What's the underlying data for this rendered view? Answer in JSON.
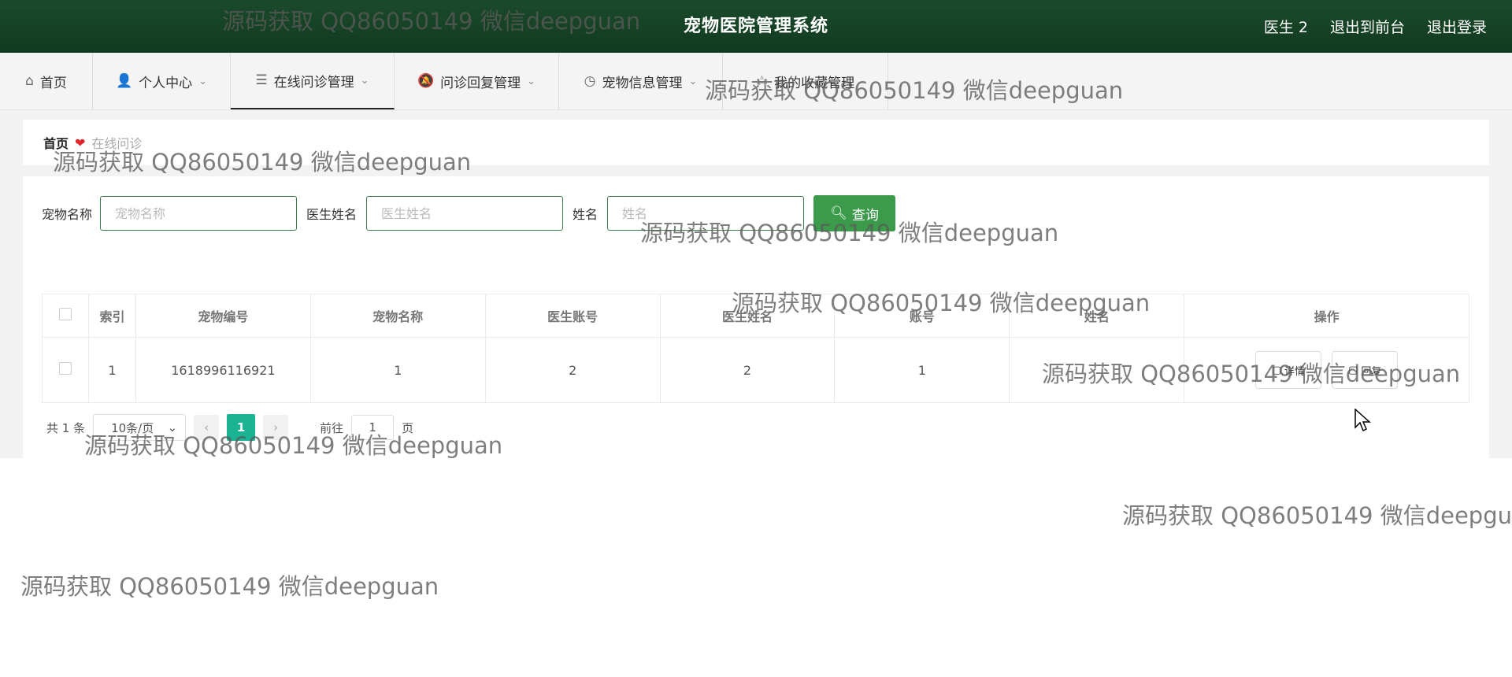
{
  "header": {
    "title": "宠物医院管理系统",
    "user": "医生 2",
    "to_frontend": "退出到前台",
    "logout": "退出登录"
  },
  "nav": {
    "items": [
      {
        "label": "首页",
        "icon": "home-icon"
      },
      {
        "label": "个人中心",
        "icon": "user-icon"
      },
      {
        "label": "在线问诊管理",
        "icon": "list-icon"
      },
      {
        "label": "问诊回复管理",
        "icon": "bell-icon"
      },
      {
        "label": "宠物信息管理",
        "icon": "clock-icon"
      },
      {
        "label": "我的收藏管理",
        "icon": "star-icon"
      }
    ],
    "active_index": 2
  },
  "breadcrumb": {
    "home": "首页",
    "current": "在线问诊"
  },
  "search": {
    "pet_name_label": "宠物名称",
    "pet_name_placeholder": "宠物名称",
    "doctor_name_label": "医生姓名",
    "doctor_name_placeholder": "医生姓名",
    "name_label": "姓名",
    "name_placeholder": "姓名",
    "query_button": "查询"
  },
  "table": {
    "columns": [
      "索引",
      "宠物编号",
      "宠物名称",
      "医生账号",
      "医生姓名",
      "账号",
      "姓名",
      "操作"
    ],
    "rows": [
      {
        "index": "1",
        "pet_no": "1618996116921",
        "pet_name": "1",
        "doctor_account": "2",
        "doctor_name": "2",
        "account": "1",
        "name": ""
      }
    ],
    "actions": {
      "detail": "详情",
      "reply": "回复"
    }
  },
  "pagination": {
    "total": "共 1 条",
    "page_size": "10条/页",
    "current_page": "1",
    "goto_prefix": "前往",
    "goto_value": "1",
    "goto_suffix": "页"
  },
  "watermark": "源码获取 QQ86050149 微信deepguan",
  "colors": {
    "header_bg": "#123a20",
    "query_button": "#3b9b4a",
    "active_page": "#1ab394",
    "breadcrumb_heart": "#e0262b"
  }
}
